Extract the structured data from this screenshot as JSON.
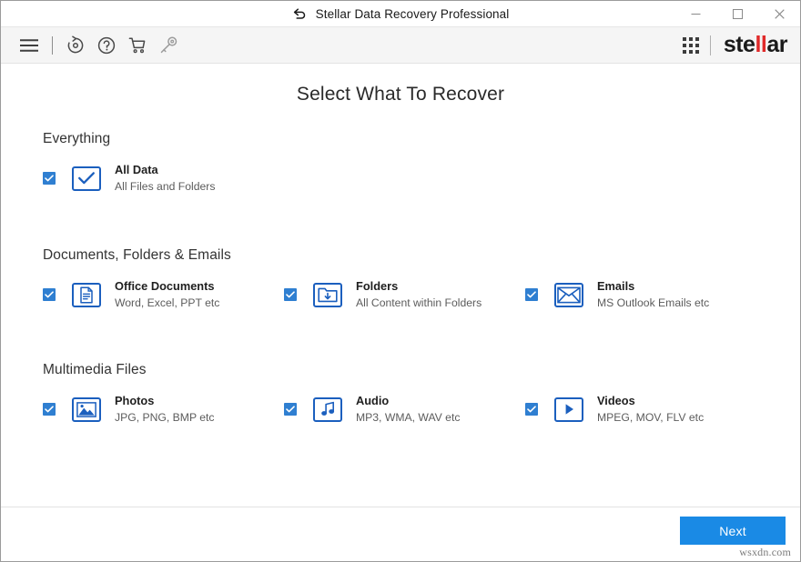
{
  "window": {
    "title": "Stellar Data Recovery Professional",
    "controls": {
      "minimize": "–",
      "maximize": "□",
      "close": "×"
    }
  },
  "toolbar": {
    "icons": [
      {
        "name": "hamburger-menu-icon",
        "label": "Menu"
      },
      {
        "name": "refresh-restore-icon",
        "label": "Resume Recovery"
      },
      {
        "name": "help-icon",
        "label": "Help"
      },
      {
        "name": "cart-icon",
        "label": "Buy Now"
      },
      {
        "name": "key-icon",
        "label": "Activation"
      }
    ],
    "apps_grid": "apps-grid-icon",
    "logo": {
      "prefix": "ste",
      "accent": "ll",
      "suffix": "ar",
      "accent_color": "#e02a2a"
    }
  },
  "main": {
    "page_title": "Select What To Recover",
    "sections": [
      {
        "title": "Everything",
        "options": [
          {
            "label": "All Data",
            "sublabel": "All Files and Folders",
            "icon": "check-badge-icon",
            "checked": true
          }
        ]
      },
      {
        "title": "Documents, Folders & Emails",
        "options": [
          {
            "label": "Office Documents",
            "sublabel": "Word, Excel, PPT etc",
            "icon": "document-icon",
            "checked": true
          },
          {
            "label": "Folders",
            "sublabel": "All Content within Folders",
            "icon": "folder-download-icon",
            "checked": true
          },
          {
            "label": "Emails",
            "sublabel": "MS Outlook Emails etc",
            "icon": "envelope-icon",
            "checked": true
          }
        ]
      },
      {
        "title": "Multimedia Files",
        "options": [
          {
            "label": "Photos",
            "sublabel": "JPG, PNG, BMP etc",
            "icon": "photo-icon",
            "checked": true
          },
          {
            "label": "Audio",
            "sublabel": "MP3, WMA, WAV etc",
            "icon": "music-note-icon",
            "checked": true
          },
          {
            "label": "Videos",
            "sublabel": "MPEG, MOV, FLV etc",
            "icon": "play-icon",
            "checked": true
          }
        ]
      }
    ]
  },
  "footer": {
    "next_label": "Next",
    "watermark": "wsxdn.com"
  },
  "colors": {
    "accent_blue": "#1a8ae5",
    "icon_blue": "#1b5fbe",
    "checkbox_blue": "#2f7fd1",
    "logo_red": "#e02a2a",
    "toolbar_bg": "#f5f5f5"
  }
}
